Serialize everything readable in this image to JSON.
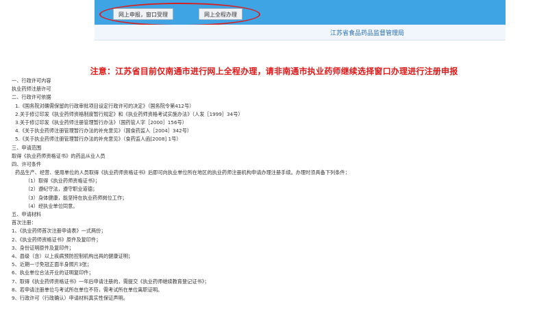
{
  "header": {
    "tabs": [
      {
        "label": "网上申报，窗口受理"
      },
      {
        "label": "网上全程办理"
      }
    ],
    "agency": "江苏省食品药品监督管理局"
  },
  "notice": "注意：江苏省目前仅南通市进行网上全程办理，请非南通市执业药师继续选择窗口办理进行注册申报",
  "lines": [
    "一、行政许可内容",
    "执业药师注册许可",
    "二、行政许可依据",
    "1.《国务院对确需保留的行政审批项目设定行政许可的决定》（国务院令第412号）",
    "2.关于修订印发《执业药师资格制度暂行规定》和《执业药师资格考试实施办法》（人发［1999］34号）",
    "3.关于修订印发《执业药师注册管理暂行办法》（国药管人字［2000］156号）",
    "4.《关于执业药师注册管理暂行办法的补充意见》（国食药监人［2004］342号）",
    "5.《关于执业药师注册管理暂行办法的补充意见》（食药监人函[2008] 1号）",
    "三、申请范围",
    "取得《执业药师资格证书》的药品从业人员",
    "四、许可条件",
    "药品生产、经营、使用单位的人员取得《执业药师资格证书》后即可向执业单位所在地区的执业药师注册机构申请办理注册手续。办理时须具备下列条件：",
    "（1）取得《执业药师资格证书》；",
    "（2）遵纪守法，遵守职业道德；",
    "（3）身体健康，能坚持在执业药师岗位工作；",
    "（4）经执业单位同意。",
    "五、申请材料",
    "首次注册：",
    "1、《执业药师首次注册申请表》一式两份；",
    "2、《执业药师资格证书》原件及复印件；",
    "3、身份证明原件及复印件；",
    "4、县级（含）以上疾病预防控制机构出具的健康证明；",
    "5、近期一寸免冠正面半身照片3张；",
    "6、执业单位合法开业的证明复印件；",
    "7、取得《执业药师资格证书》一年后申请注册的，需提交《执业药师继续教育登记证书》；",
    "8、若申请注册单位与考试所在单位不符，需考试所在单位离职证明。",
    "9、行政许可（行政确认）申请材料真实性保证声明。"
  ]
}
